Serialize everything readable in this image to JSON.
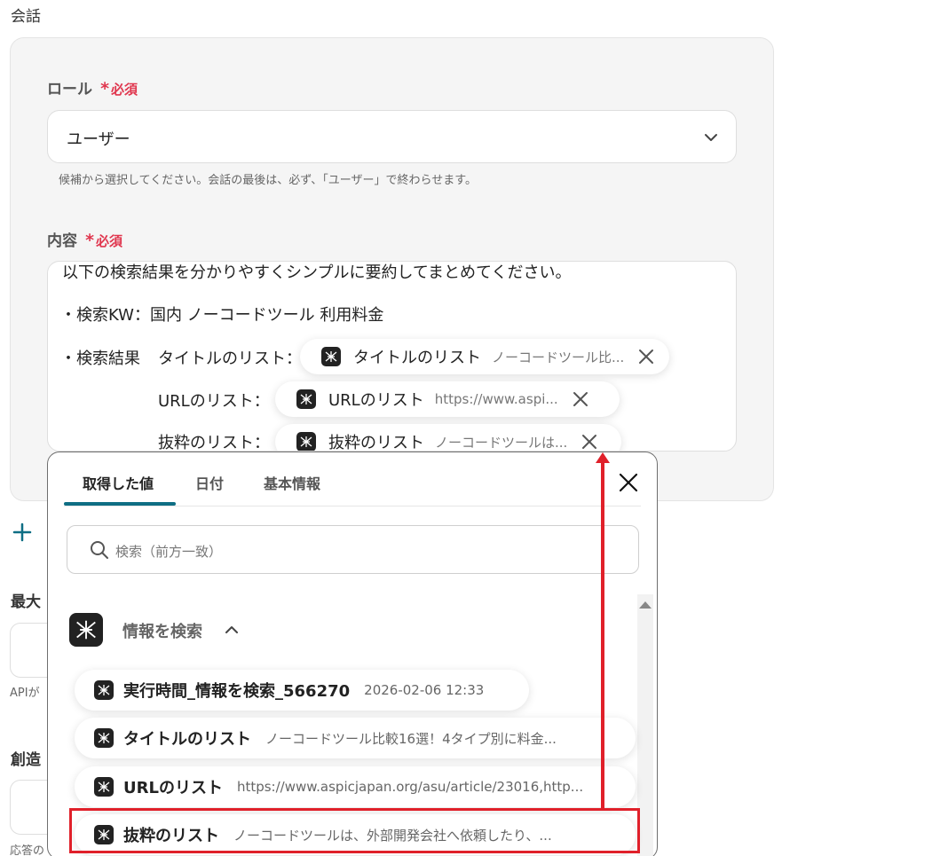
{
  "section": {
    "title": "会話"
  },
  "role": {
    "label": "ロール",
    "required_star": "*",
    "required_text": "必須",
    "value": "ユーザー",
    "help": "候補から選択してください。会話の最後は、必ず、「ユーザー」で終わらせます。"
  },
  "content": {
    "label": "内容",
    "required_star": "*",
    "required_text": "必須",
    "line1": "以下の検索結果を分かりやすくシンプルに要約してまとめてください。",
    "line2": "・検索KW：国内 ノーコードツール 利用料金",
    "line3_prefix": "・検索結果",
    "row_labels": [
      "タイトルのリスト：",
      "URLのリスト：",
      "抜粋のリスト："
    ],
    "chips": [
      {
        "name": "タイトルのリスト",
        "value": "ノーコードツール比..."
      },
      {
        "name": "URLのリスト",
        "value": "https://www.aspi..."
      },
      {
        "name": "抜粋のリスト",
        "value": "ノーコードツールは..."
      }
    ]
  },
  "background": {
    "label_max": "最大",
    "api_text": "APIが",
    "label_creative": "創造",
    "answer_text": "応答の"
  },
  "popup": {
    "tabs": [
      "取得した値",
      "日付",
      "基本情報"
    ],
    "active_tab": 0,
    "search_placeholder": "検索（前方一致）",
    "group_title": "情報を検索",
    "items": [
      {
        "name": "実行時間_情報を検索_566270",
        "value": "2026-02-06 12:33"
      },
      {
        "name": "タイトルのリスト",
        "value": "ノーコードツール比較16選！4タイプ別に料金..."
      },
      {
        "name": "URLのリスト",
        "value": "https://www.aspicjapan.org/asu/article/23016,http..."
      },
      {
        "name": "抜粋のリスト",
        "value": "ノーコードツールは、外部開発会社へ依頼したり、..."
      }
    ]
  },
  "colors": {
    "required": "#e0364e",
    "tab_accent": "#0e6e84",
    "highlight": "#e0202a"
  }
}
